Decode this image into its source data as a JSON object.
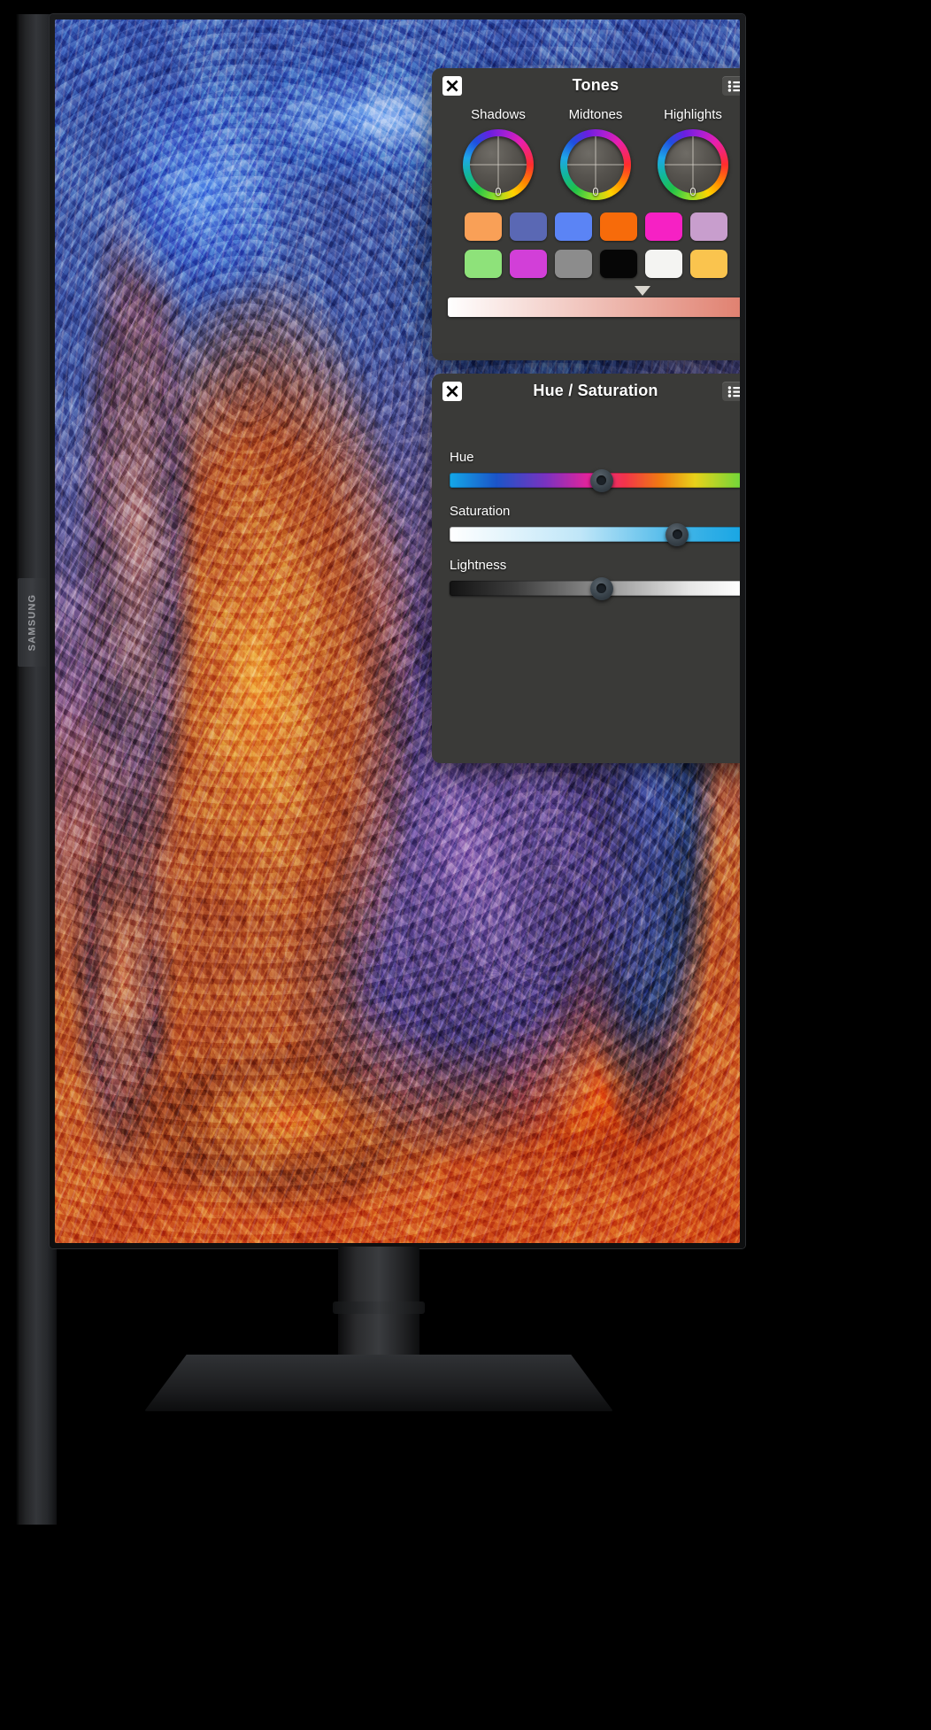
{
  "device": {
    "brand": "SAMSUNG",
    "brand_badge_name": "samsung-logo"
  },
  "tones_panel": {
    "title": "Tones",
    "close_icon": "close-icon",
    "menu_icon": "list-menu-icon",
    "wheels": [
      {
        "label": "Shadows",
        "value": "0"
      },
      {
        "label": "Midtones",
        "value": "0"
      },
      {
        "label": "Highlights",
        "value": "0"
      }
    ],
    "swatches": [
      {
        "name": "swatch-orange-light",
        "color": "#f9a057"
      },
      {
        "name": "swatch-indigo",
        "color": "#5a68b4"
      },
      {
        "name": "swatch-blue",
        "color": "#5b84f5"
      },
      {
        "name": "swatch-orange",
        "color": "#f76b0a"
      },
      {
        "name": "swatch-magenta",
        "color": "#f621c4"
      },
      {
        "name": "swatch-lilac",
        "color": "#c89ecd"
      },
      {
        "name": "swatch-green-light",
        "color": "#8ee27a"
      },
      {
        "name": "swatch-orchid",
        "color": "#d23fd8"
      },
      {
        "name": "swatch-grey",
        "color": "#8c8c8c"
      },
      {
        "name": "swatch-black",
        "color": "#060606"
      },
      {
        "name": "swatch-white",
        "color": "#f4f4f2"
      },
      {
        "name": "swatch-yellow",
        "color": "#fac44e"
      }
    ],
    "gradient": {
      "name": "tone-gradient-bar",
      "from": "#ffffff",
      "to": "#e0806f",
      "marker_position_percent": 66
    }
  },
  "hue_saturation_panel": {
    "title": "Hue / Saturation",
    "close_icon": "close-icon",
    "menu_icon": "list-menu-icon",
    "sliders": [
      {
        "label": "Hue",
        "name": "hue-slider",
        "knob_position_percent": 52,
        "gradient": "linear-gradient(90deg,#14a8e8 0%,#1b55c8 16%,#7a32c0 33%,#e8239a 48%,#f2344a 60%,#f07a12 72%,#e8d21a 84%,#6fd63a 100%)"
      },
      {
        "label": "Saturation",
        "name": "saturation-slider",
        "knob_position_percent": 78,
        "gradient": "linear-gradient(90deg,#ffffff 0%,#bfe6f8 45%,#46b6e8 78%,#18a6e4 100%)"
      },
      {
        "label": "Lightness",
        "name": "lightness-slider",
        "knob_position_percent": 52,
        "gradient": "linear-gradient(90deg,#131313 0%,#3c3c3c 22%,#9a9a9a 55%,#e6e6e6 82%,#ffffff 100%)"
      }
    ]
  }
}
